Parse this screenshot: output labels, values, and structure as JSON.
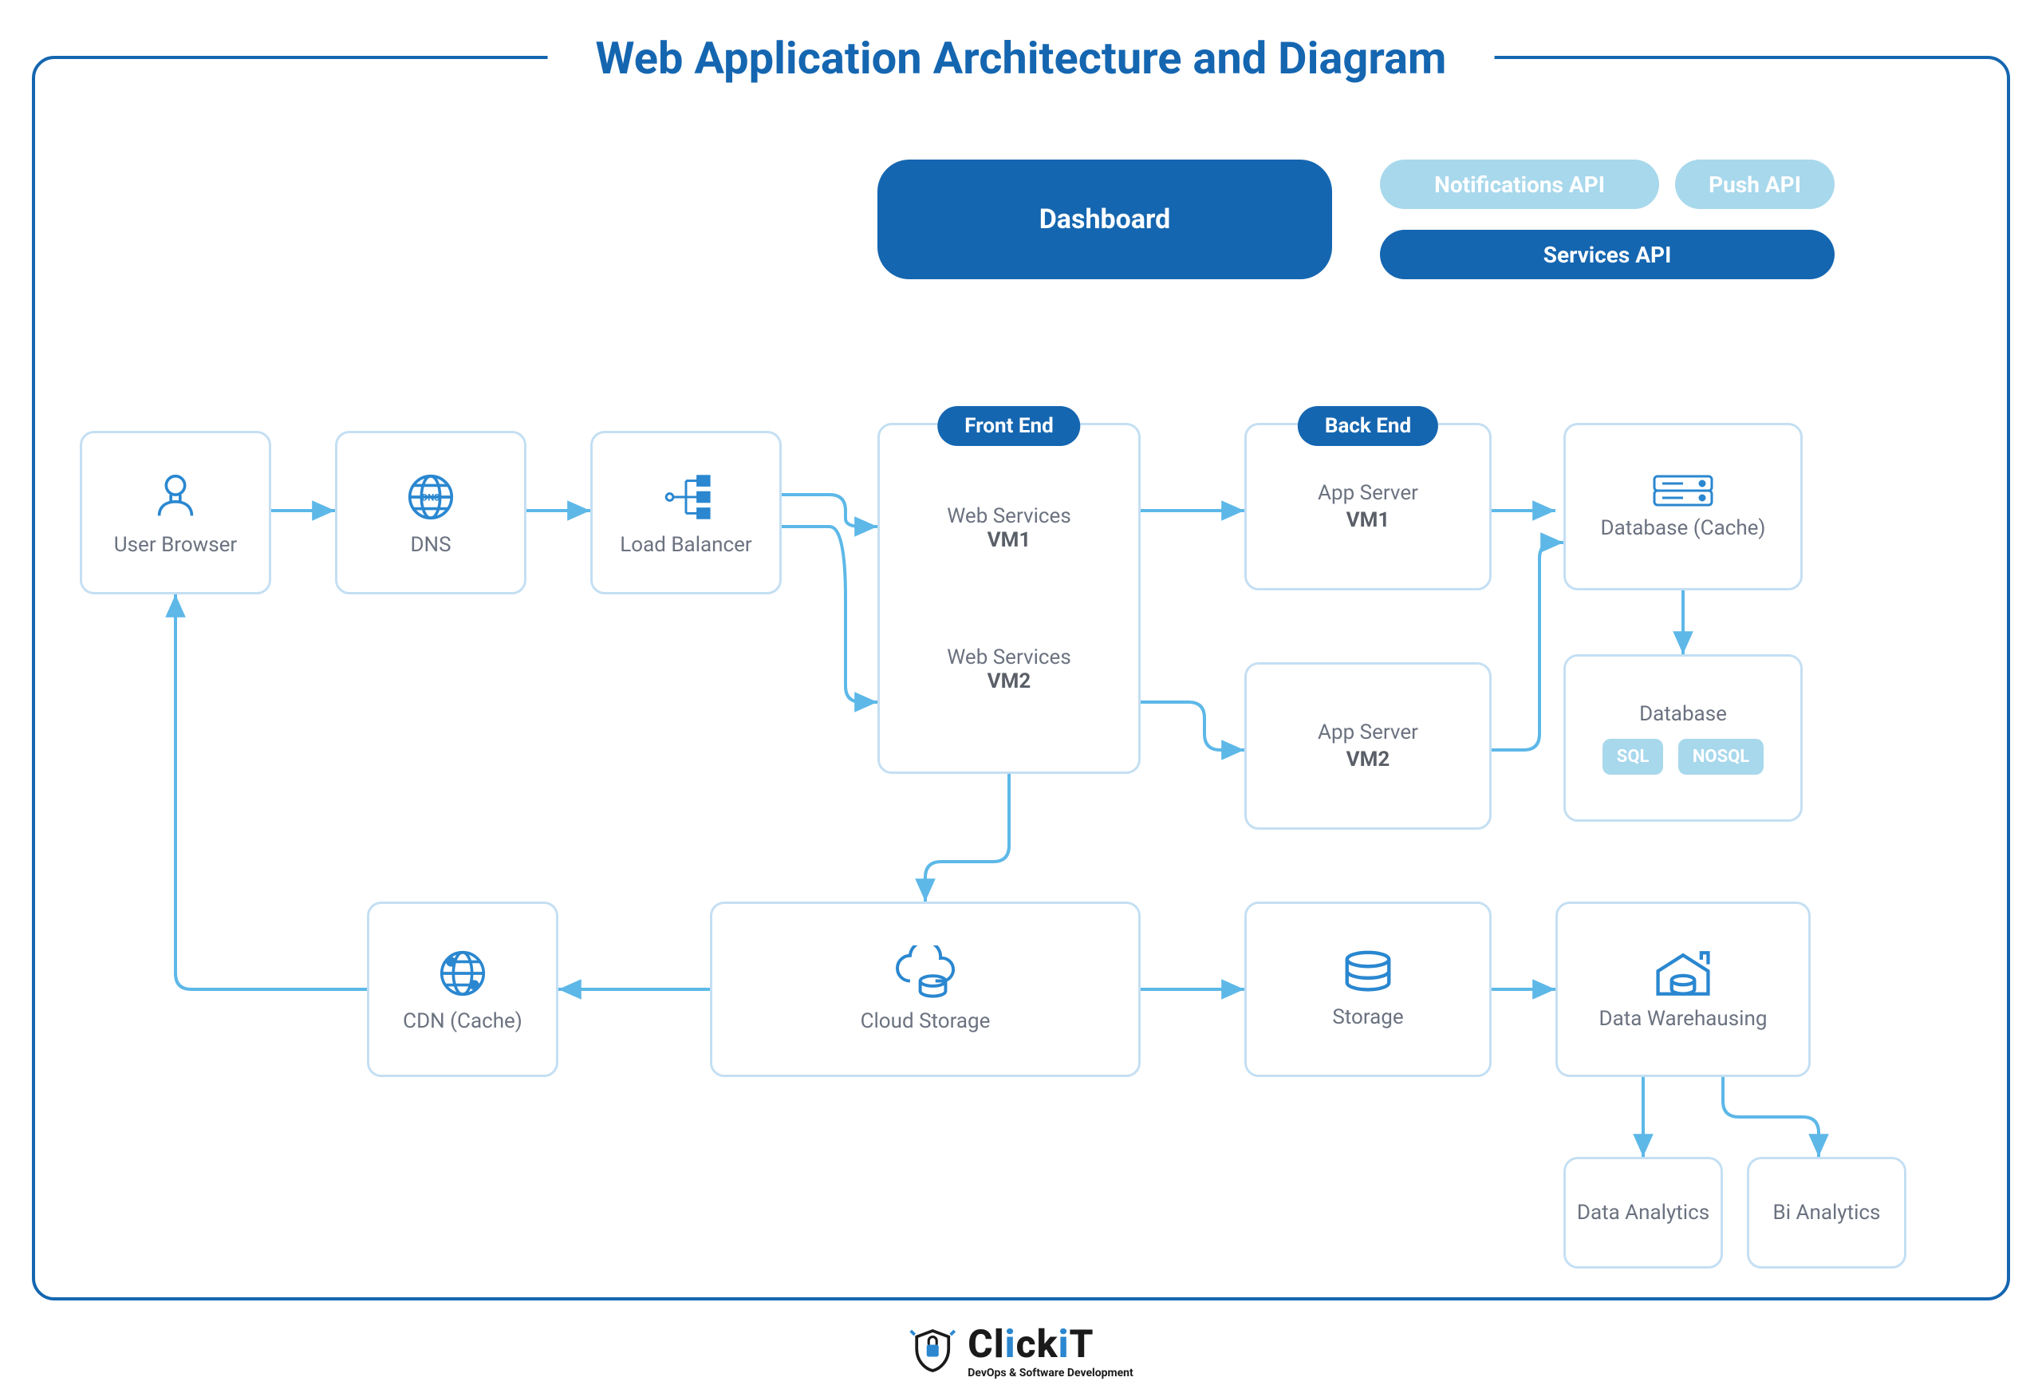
{
  "title": "Web Application Architecture and Diagram",
  "pills": {
    "dashboard": "Dashboard",
    "notifications_api": "Notifications API",
    "push_api": "Push API",
    "services_api": "Services API"
  },
  "tags": {
    "frontend": "Front End",
    "backend": "Back End"
  },
  "nodes": {
    "user_browser": "User Browser",
    "dns": "DNS",
    "dns_badge": "DNS",
    "load_balancer": "Load Balancer",
    "web_services": "Web Services",
    "vm1": "VM1",
    "vm2": "VM2",
    "app_server": "App Server",
    "database_cache": "Database (Cache)",
    "database": "Database",
    "sql": "SQL",
    "nosql": "NOSQL",
    "cdn_cache": "CDN (Cache)",
    "cloud_storage": "Cloud Storage",
    "storage": "Storage",
    "data_warehousing": "Data Warehausing",
    "data_analytics": "Data Analytics",
    "bi_analytics": "Bi Analytics"
  },
  "logo": {
    "name": "ClickIT",
    "tagline": "DevOps & Software Development"
  }
}
